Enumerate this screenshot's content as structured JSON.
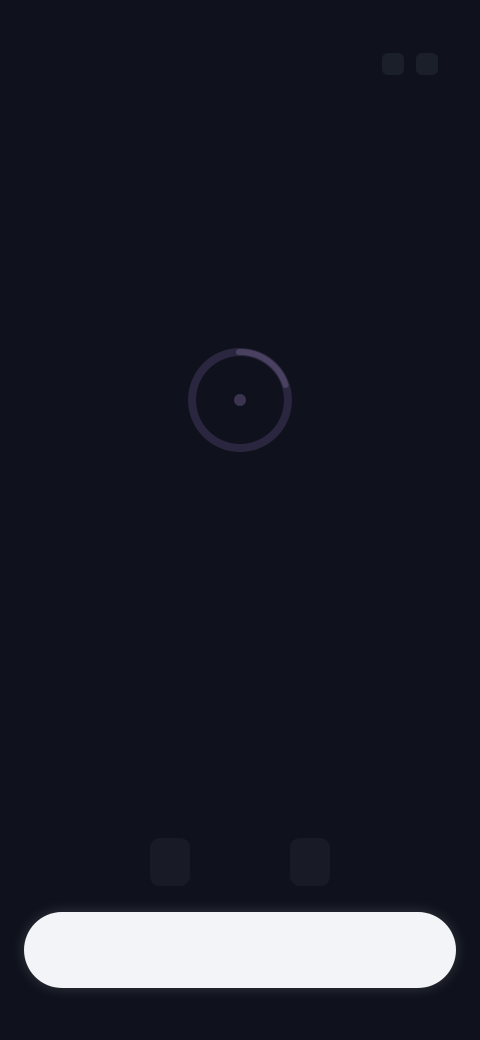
{
  "status": {
    "left_line1": "",
    "left_line2": "",
    "right_line1": "",
    "right_line2": ""
  },
  "main": {
    "icon": "spinner-ring-icon",
    "headline": "",
    "subtext": ""
  },
  "chips": [
    "",
    ""
  ],
  "primary_button": {
    "label": ""
  },
  "colors": {
    "background": "#0f121c",
    "button": "#f3f4f7",
    "ring": "#4a4060"
  }
}
